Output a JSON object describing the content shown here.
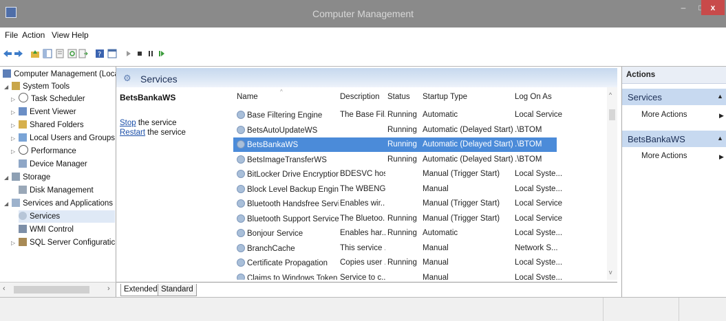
{
  "window": {
    "title": "Computer Management",
    "minimize": "–",
    "maximize": "□",
    "close": "x"
  },
  "menu": [
    "File",
    "Action",
    "View",
    "Help"
  ],
  "tree": {
    "root": "Computer Management (Local",
    "system_tools": "System Tools",
    "task_scheduler": "Task Scheduler",
    "event_viewer": "Event Viewer",
    "shared_folders": "Shared Folders",
    "local_users": "Local Users and Groups",
    "performance": "Performance",
    "device_manager": "Device Manager",
    "storage": "Storage",
    "disk_management": "Disk Management",
    "services_apps": "Services and Applications",
    "services": "Services",
    "wmi_control": "WMI Control",
    "sql_server": "SQL Server Configuratic"
  },
  "center": {
    "header": "Services",
    "selected_service": "BetsBankaWS",
    "stop_link": "Stop",
    "stop_rest": " the service",
    "restart_link": "Restart",
    "restart_rest": " the service",
    "columns": [
      "Name",
      "Description",
      "Status",
      "Startup Type",
      "Log On As"
    ],
    "rows": [
      [
        "Base Filtering Engine",
        "The Base Fil...",
        "Running",
        "Automatic",
        "Local Service"
      ],
      [
        "BetsAutoUpdateWS",
        "",
        "Running",
        "Automatic (Delayed Start)",
        ".\\BTOM"
      ],
      [
        "BetsBankaWS",
        "",
        "Running",
        "Automatic (Delayed Start)",
        ".\\BTOM"
      ],
      [
        "BetsImageTransferWS",
        "",
        "Running",
        "Automatic (Delayed Start)",
        ".\\BTOM"
      ],
      [
        "BitLocker Drive Encryption ...",
        "BDESVC hos...",
        "",
        "Manual (Trigger Start)",
        "Local Syste..."
      ],
      [
        "Block Level Backup Engine ...",
        "The WBENG...",
        "",
        "Manual",
        "Local Syste..."
      ],
      [
        "Bluetooth Handsfree Service",
        "Enables wir...",
        "",
        "Manual (Trigger Start)",
        "Local Service"
      ],
      [
        "Bluetooth Support Service",
        "The Bluetoo...",
        "Running",
        "Manual (Trigger Start)",
        "Local Service"
      ],
      [
        "Bonjour Service",
        "Enables har...",
        "Running",
        "Automatic",
        "Local Syste..."
      ],
      [
        "BranchCache",
        "This service ...",
        "",
        "Manual",
        "Network S..."
      ],
      [
        "Certificate Propagation",
        "Copies user ...",
        "Running",
        "Manual",
        "Local Syste..."
      ],
      [
        "Claims to Windows Token S...",
        "Service to c...",
        "",
        "Manual",
        "Local Syste..."
      ]
    ],
    "selected_index": 2,
    "tabs": [
      "Extended",
      "Standard"
    ]
  },
  "actions": {
    "header": "Actions",
    "group1": "Services",
    "group1_more": "More Actions",
    "group2": "BetsBankaWS",
    "group2_more": "More Actions"
  }
}
